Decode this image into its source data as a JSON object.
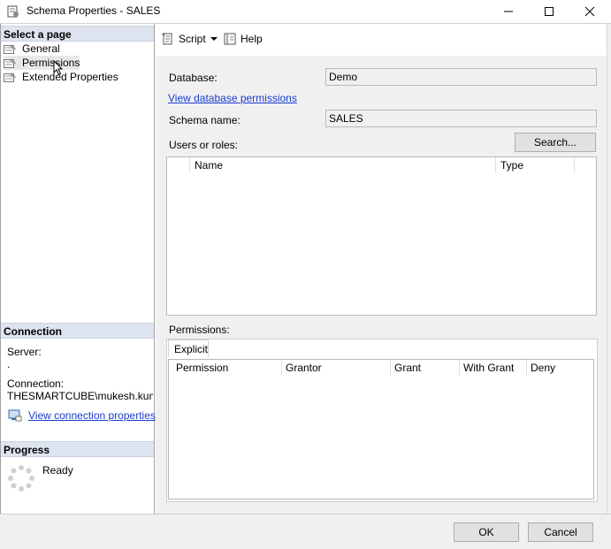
{
  "window": {
    "title": "Schema Properties - SALES",
    "minimize_icon": "minimize-icon",
    "maximize_icon": "maximize-icon",
    "close_icon": "close-icon"
  },
  "left": {
    "select_page_header": "Select a page",
    "pages": [
      {
        "label": "General",
        "icon": "page-wrench-icon"
      },
      {
        "label": "Permissions",
        "icon": "page-wrench-icon"
      },
      {
        "label": "Extended Properties",
        "icon": "page-wrench-icon"
      }
    ],
    "connection_header": "Connection",
    "server_label": "Server:",
    "server_value": ".",
    "connection_label": "Connection:",
    "connection_value": "THESMARTCUBE\\mukesh.kumar",
    "view_connection_link": "View connection properties",
    "progress_header": "Progress",
    "progress_status": "Ready"
  },
  "toolbar": {
    "script_label": "Script",
    "help_label": "Help"
  },
  "form": {
    "database_label": "Database:",
    "database_value": "Demo",
    "view_db_permissions_link": "View database permissions",
    "schema_name_label": "Schema name:",
    "schema_name_value": "SALES",
    "users_roles_label": "Users or roles:",
    "search_button": "Search...",
    "users_columns": [
      "Name",
      "Type"
    ],
    "permissions_label": "Permissions:",
    "permissions_tab": "Explicit",
    "permissions_columns": [
      "Permission",
      "Grantor",
      "Grant",
      "With Grant",
      "Deny"
    ]
  },
  "footer": {
    "ok_label": "OK",
    "cancel_label": "Cancel"
  },
  "colors": {
    "section_header_bg": "#dde4ef",
    "link": "#1a3ccf",
    "panel_bg": "#f0f0f0"
  }
}
